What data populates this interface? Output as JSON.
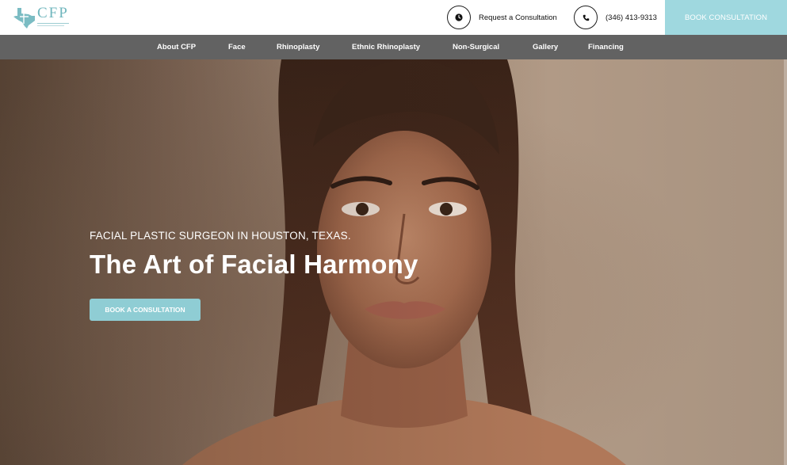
{
  "brand": {
    "logo_text": "CFP",
    "accent_color": "#9fd8df",
    "nav_background": "#626262"
  },
  "header": {
    "request": {
      "label": "Request a Consultation",
      "icon": "clock-icon"
    },
    "phone": {
      "label": "(346) 413-9313",
      "icon": "phone-icon"
    },
    "book_button": "BOOK CONSULTATION"
  },
  "nav": {
    "items": [
      {
        "label": "About CFP"
      },
      {
        "label": "Face"
      },
      {
        "label": "Rhinoplasty"
      },
      {
        "label": "Ethnic Rhinoplasty"
      },
      {
        "label": "Non-Surgical"
      },
      {
        "label": "Gallery"
      },
      {
        "label": "Financing"
      }
    ]
  },
  "hero": {
    "eyebrow": "FACIAL PLASTIC SURGEON IN HOUSTON, TEXAS.",
    "headline": "The Art of Facial Harmony",
    "cta": "BOOK A CONSULTATION"
  }
}
